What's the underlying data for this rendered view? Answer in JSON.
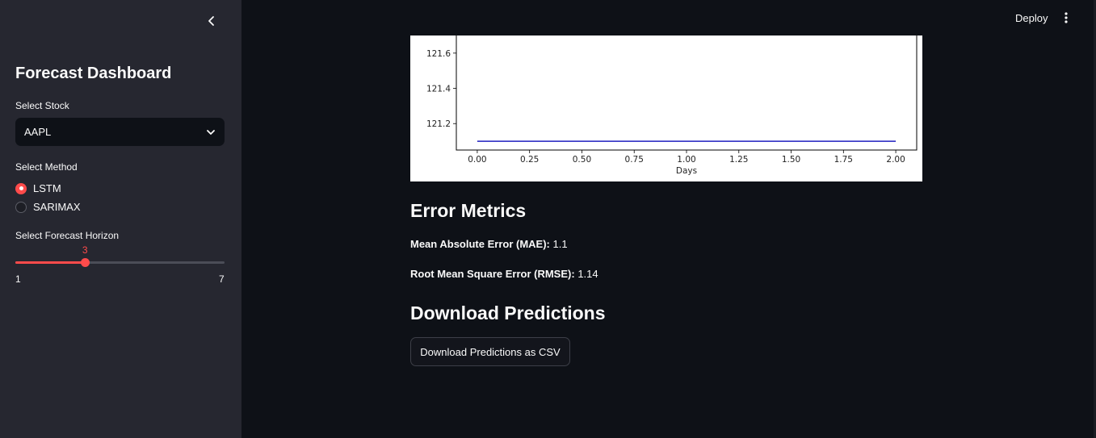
{
  "sidebar": {
    "title": "Forecast Dashboard",
    "stock_label": "Select Stock",
    "stock_value": "AAPL",
    "method_label": "Select Method",
    "methods": [
      {
        "label": "LSTM",
        "selected": true
      },
      {
        "label": "SARIMAX",
        "selected": false
      }
    ],
    "horizon_label": "Select Forecast Horizon",
    "horizon": {
      "value": "3",
      "min": "1",
      "max": "7",
      "fraction": 0.333
    }
  },
  "header": {
    "deploy_label": "Deploy"
  },
  "main": {
    "error_title": "Error Metrics",
    "mae_label": "Mean Absolute Error (MAE):",
    "mae_value": "1.1",
    "rmse_label": "Root Mean Square Error (RMSE):",
    "rmse_value": "1.14",
    "download_title": "Download Predictions",
    "download_button": "Download Predictions as CSV"
  },
  "chart_data": {
    "type": "line",
    "title": "",
    "xlabel": "Days",
    "ylabel": "",
    "x_ticks": [
      "0.00",
      "0.25",
      "0.50",
      "0.75",
      "1.00",
      "1.25",
      "1.50",
      "1.75",
      "2.00"
    ],
    "y_ticks": [
      "121.2",
      "121.4",
      "121.6"
    ],
    "xlim": [
      -0.1,
      2.1
    ],
    "ylim": [
      121.05,
      121.7
    ],
    "series": [
      {
        "color": "#1f1fbf",
        "x": [
          0,
          1,
          2
        ],
        "y": [
          121.1,
          121.1,
          121.1
        ]
      }
    ]
  },
  "colors": {
    "accent": "#ff4b4b",
    "sidebar_bg": "#262730",
    "main_bg": "#0e1117"
  }
}
